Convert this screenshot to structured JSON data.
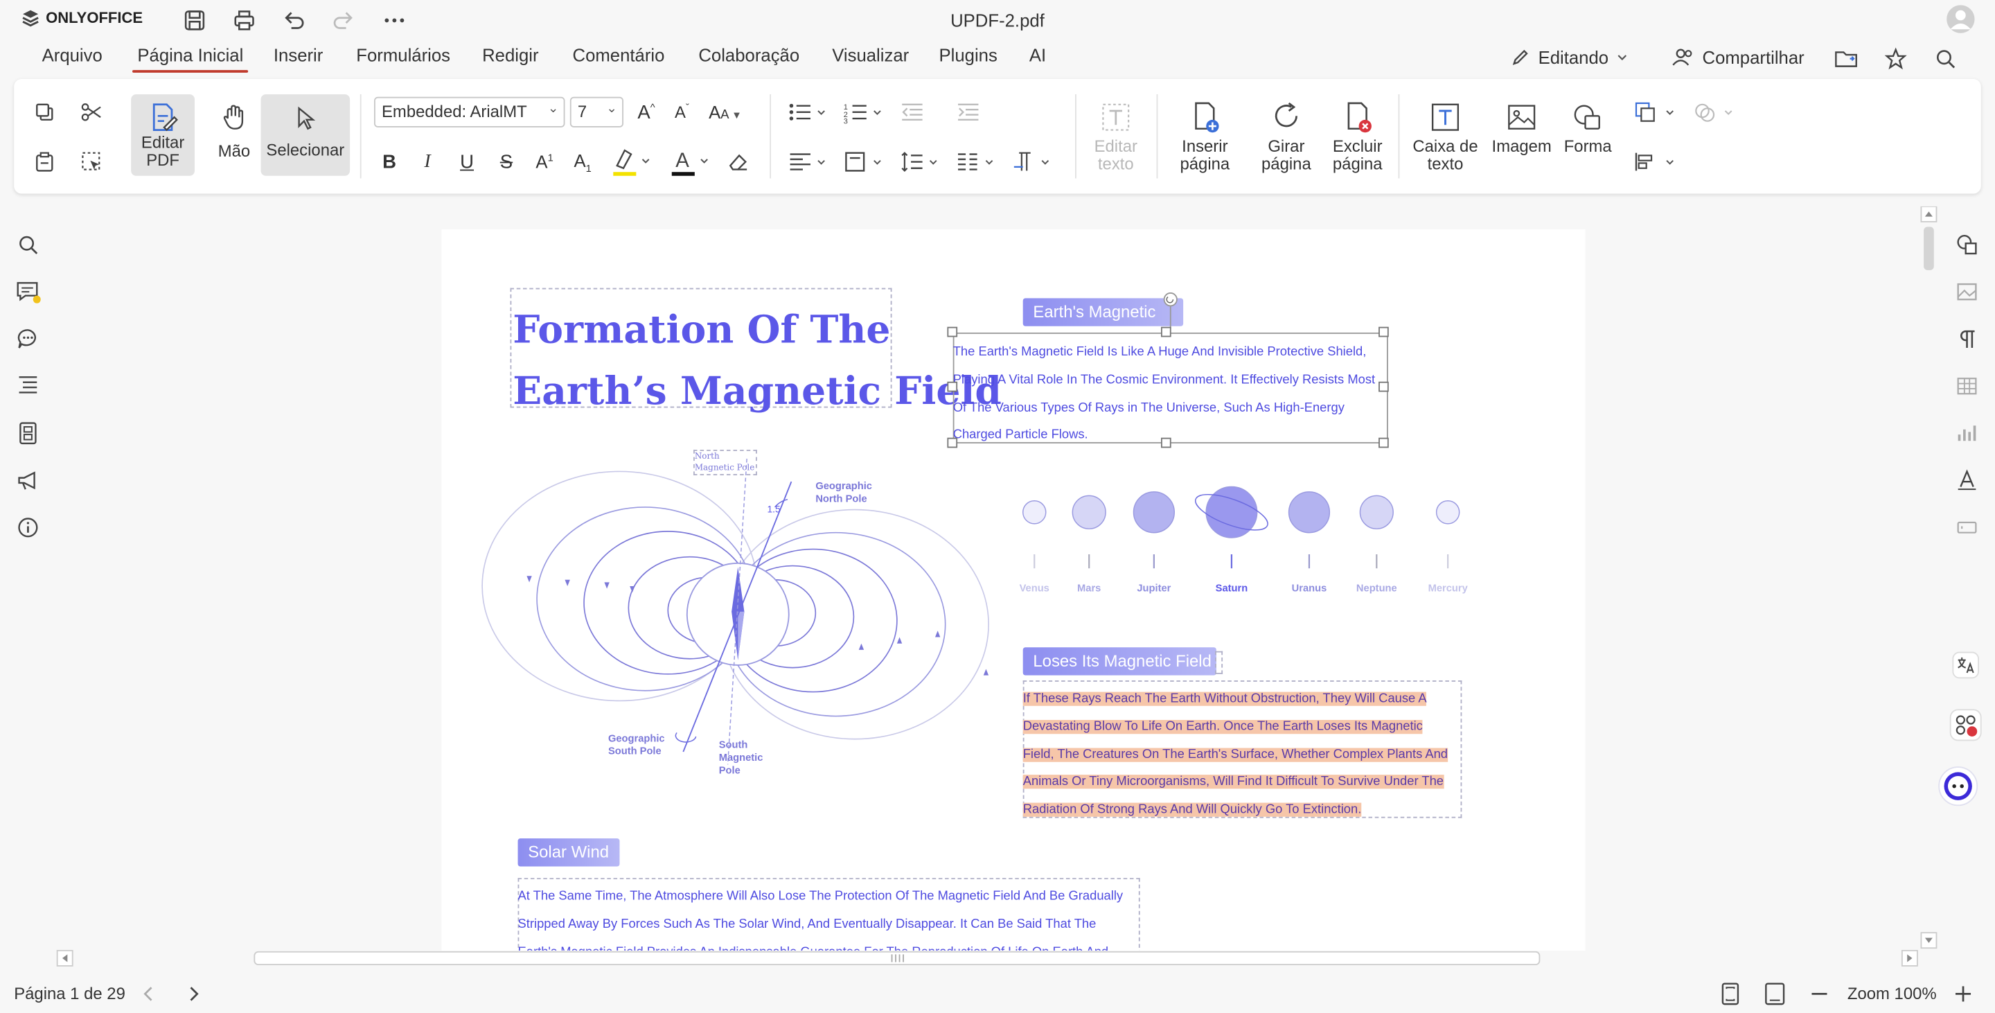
{
  "app": {
    "brand": "ONLYOFFICE",
    "doc_title": "UPDF-2.pdf"
  },
  "menu": {
    "tabs": [
      "Arquivo",
      "Página Inicial",
      "Inserir",
      "Formulários",
      "Redigir",
      "Comentário",
      "Colaboração",
      "Visualizar",
      "Plugins",
      "AI"
    ],
    "active": "Página Inicial",
    "editing_label": "Editando",
    "share_label": "Compartilhar"
  },
  "toolbar": {
    "edit_pdf_label": "Editar PDF",
    "hand_label": "Mão",
    "select_label": "Selecionar",
    "font_name": "Embedded: ArialMT",
    "font_size": "7",
    "edit_text_label": "Editar texto",
    "insert_page_label": "Inserir página",
    "rotate_page_label": "Girar página",
    "delete_page_label": "Excluir página",
    "text_box_label": "Caixa de texto",
    "image_label": "Imagem",
    "shape_label": "Forma",
    "highlight_color": "#f3e200",
    "font_color": "#111111"
  },
  "document": {
    "title": "Formation Of The Earth’s Magnetic Field",
    "title_line1": "Formation Of The",
    "title_line2": "Earth’s Magnetic Field",
    "diagram": {
      "north_magnetic_pole": "North Magnetic Pole",
      "north_magnetic_pole_l1": "North",
      "north_magnetic_pole_l2": "Magnetic Pole",
      "geographic_north": "Geographic North Pole",
      "geographic_north_l1": "Geographic",
      "geographic_north_l2": "North Pole",
      "angle": "1.5",
      "geographic_south_l1": "Geographic",
      "geographic_south_l2": "South Pole",
      "south_magnetic_l1": "South",
      "south_magnetic_l2": "Magnetic",
      "south_magnetic_l3": "Pole"
    },
    "section1": {
      "heading": "Earth's Magnetic",
      "lines": [
        "The Earth's Magnetic Field Is Like A Huge And Invisible Protective Shield,",
        "Playing A Vital Role In The Cosmic Environment. It Effectively Resists Most",
        "Of The Various Types Of Rays in The Universe, Such As High-Energy",
        "Charged Particle Flows."
      ]
    },
    "planets": [
      "Venus",
      "Mars",
      "Jupiter",
      "Saturn",
      "Uranus",
      "Neptune",
      "Mercury"
    ],
    "section2": {
      "heading": "Loses Its Magnetic Field",
      "lines": [
        "If These Rays Reach The Earth Without Obstruction, They Will Cause A",
        "Devastating Blow To Life On Earth. Once The Earth Loses Its Magnetic",
        "Field, The Creatures On The Earth's Surface, Whether Complex Plants And",
        "Animals Or Tiny Microorganisms, Will Find It Difficult To Survive Under The",
        "Radiation Of Strong Rays And Will Quickly Go To Extinction."
      ]
    },
    "section3": {
      "heading": "Solar Wind",
      "lines": [
        "At The Same Time, The Atmosphere Will Also Lose The Protection Of The Magnetic Field And Be Gradually",
        "Stripped Away By Forces Such As The Solar Wind, And Eventually Disappear. It Can Be Said That The",
        "Earth's Magnetic Field Provides An Indispensable Guarantee For The Reproduction Of Life On Earth And"
      ]
    }
  },
  "status": {
    "page_label": "Página 1 de 29",
    "zoom_label": "Zoom 100%"
  }
}
